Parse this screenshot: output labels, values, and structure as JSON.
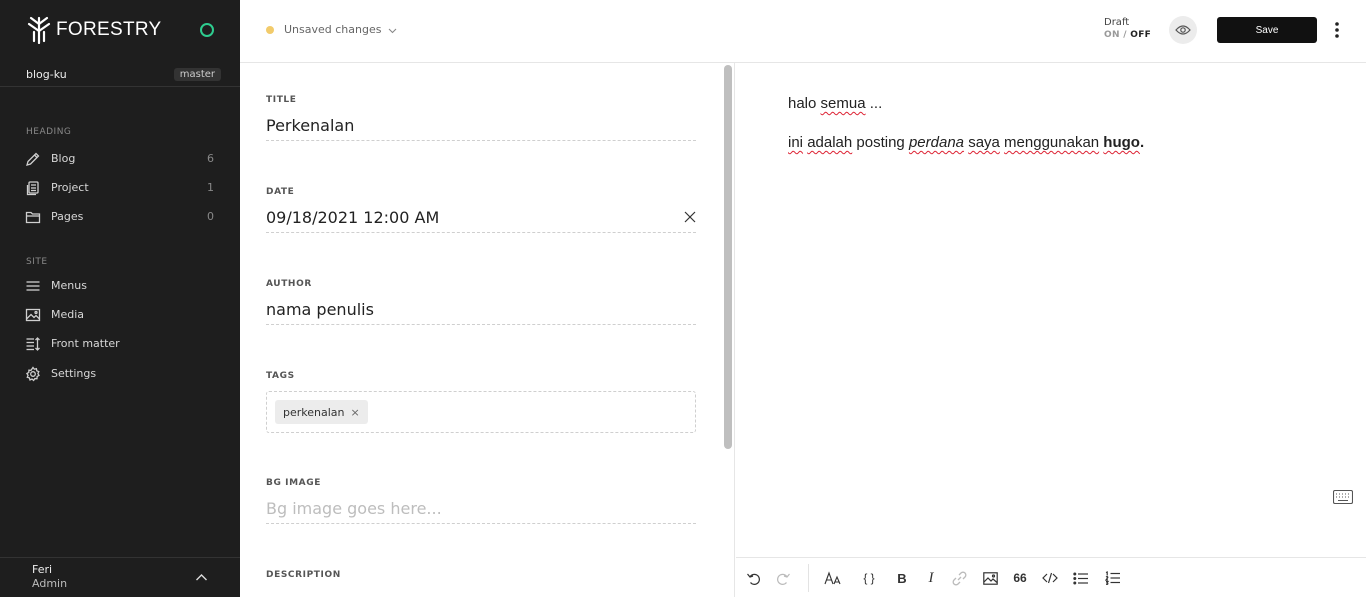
{
  "app": {
    "brand": "FORESTRY"
  },
  "repo": {
    "name": "blog-ku",
    "branch": "master"
  },
  "sidebar": {
    "heading_label": "HEADING",
    "heading_items": [
      {
        "label": "Blog",
        "count": "6",
        "icon": "pencil-icon"
      },
      {
        "label": "Project",
        "count": "1",
        "icon": "document-icon"
      },
      {
        "label": "Pages",
        "count": "0",
        "icon": "folder-icon"
      }
    ],
    "site_label": "SITE",
    "site_items": [
      {
        "label": "Menus",
        "icon": "menu-icon"
      },
      {
        "label": "Media",
        "icon": "image-icon"
      },
      {
        "label": "Front matter",
        "icon": "front-matter-icon"
      },
      {
        "label": "Settings",
        "icon": "gear-icon"
      }
    ],
    "user": {
      "name": "Feri",
      "role": "Admin"
    }
  },
  "topbar": {
    "status": "Unsaved changes",
    "status_color": "#f2cb6b",
    "draft_label": "Draft",
    "draft_on": "ON",
    "draft_sep": "/",
    "draft_off": "OFF",
    "save_label": "Save"
  },
  "form": {
    "title": {
      "label": "TITLE",
      "value": "Perkenalan"
    },
    "date": {
      "label": "DATE",
      "value": "09/18/2021 12:00 AM"
    },
    "author": {
      "label": "AUTHOR",
      "value": "nama penulis"
    },
    "tags": {
      "label": "TAGS",
      "items": [
        "perkenalan"
      ],
      "remove": "×"
    },
    "bg_image": {
      "label": "BG IMAGE",
      "placeholder": "Bg image goes here..."
    },
    "description": {
      "label": "DESCRIPTION"
    }
  },
  "editor": {
    "p1": {
      "a": "halo",
      "b": "semua",
      "c": "..."
    },
    "p2": {
      "w1": "ini",
      "w2": "adalah",
      "w3": "posting",
      "w4": "perdana",
      "w5": "saya",
      "w6": "menggunakan",
      "w7": "hugo",
      "w8": "."
    }
  },
  "toolbar": {
    "buttons": [
      "undo-icon",
      "redo-icon",
      "font-size-icon",
      "code-block-icon",
      "bold-icon",
      "italic-icon",
      "link-icon",
      "image-icon",
      "quote-icon",
      "code-icon",
      "bullet-list-icon",
      "numbered-list-icon"
    ],
    "bold": "B",
    "italic": "I",
    "quote": "66",
    "braces": "{ }"
  },
  "colors": {
    "sidebar_bg": "#1e1e1e",
    "accent_green": "#2ecc8f",
    "save_bg": "#111111"
  }
}
